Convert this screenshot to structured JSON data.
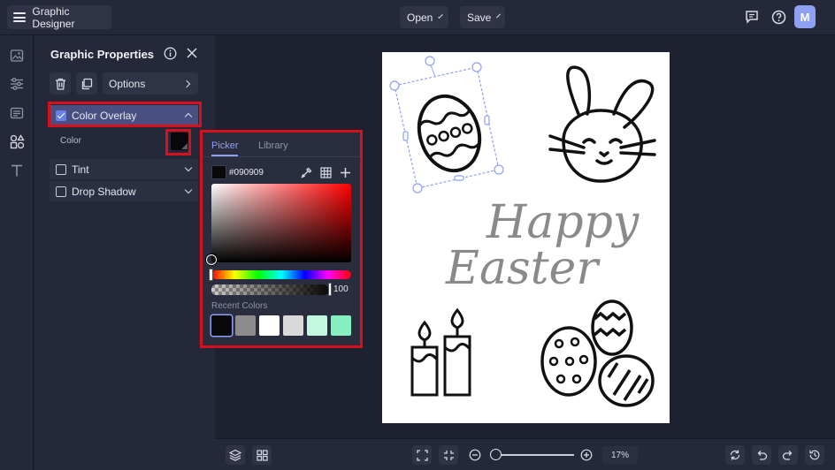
{
  "topbar": {
    "app_title": "Graphic Designer",
    "open_label": "Open",
    "save_label": "Save",
    "avatar_initial": "M"
  },
  "left_rail": {
    "icons": [
      "image-icon",
      "sliders-icon",
      "layout-icon",
      "shapes-icon",
      "text-icon"
    ],
    "active": "shapes-icon"
  },
  "panel": {
    "title": "Graphic Properties",
    "options_label": "Options",
    "sections": [
      {
        "label": "Color Overlay",
        "checked": true,
        "expanded": true
      },
      {
        "label": "Tint",
        "checked": false,
        "expanded": false
      },
      {
        "label": "Drop Shadow",
        "checked": false,
        "expanded": false
      }
    ],
    "color_label": "Color"
  },
  "picker": {
    "tabs": [
      "Picker",
      "Library"
    ],
    "active_tab": "Picker",
    "hex_value": "#090909",
    "alpha_value": "100",
    "recent_label": "Recent Colors",
    "recent_colors": [
      "#090909",
      "#8c8c8c",
      "#ffffff",
      "#d9d9d9",
      "#c2f7e0",
      "#86eec1"
    ]
  },
  "canvas": {
    "artwork_text_line1": "Happy",
    "artwork_text_line2": "Easter"
  },
  "bottombar": {
    "zoom_label": "17%",
    "zoom_fraction": 0.05
  },
  "colors": {
    "accent": "#8ea0f2",
    "highlight": "#d8101e",
    "panel_bg": "#252838",
    "stage_bg": "#1e2130",
    "active_row": "#4a4f82"
  }
}
